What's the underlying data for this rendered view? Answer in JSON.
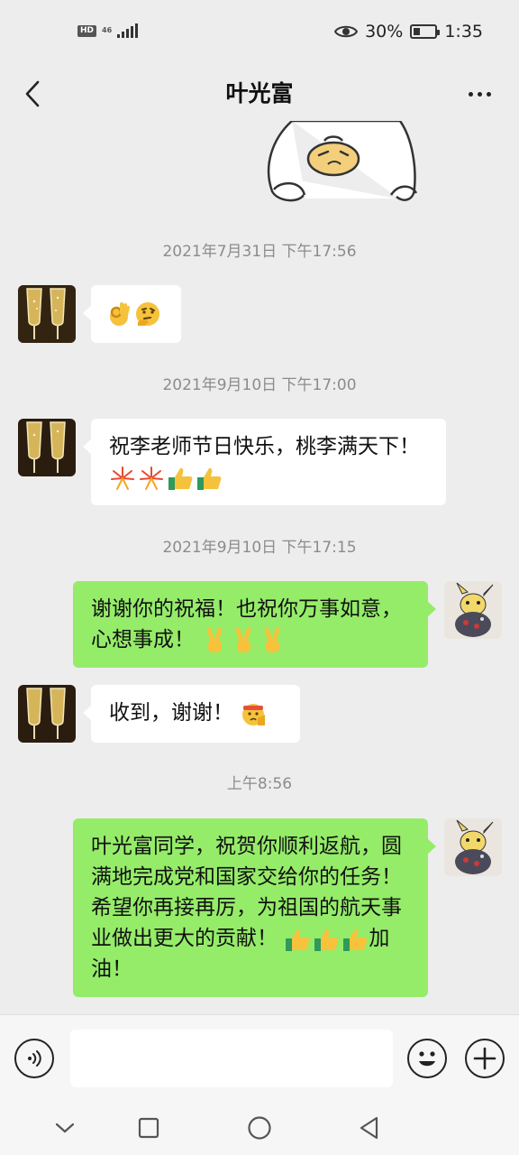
{
  "status_bar": {
    "hd": "HD",
    "network": "46",
    "battery_text": "30%",
    "battery_level": 0.3,
    "time": "1:35"
  },
  "header": {
    "title": "叶光富",
    "back_icon": "chevron-left-icon",
    "more_icon": "more-dots-icon"
  },
  "messages": {
    "ts1": "2021年7月31日 下午17:56",
    "m1_emojis": [
      "ok-hand-emoji",
      "thinking-emoji"
    ],
    "ts2": "2021年9月10日 下午17:00",
    "m2_text": "祝李老师节日快乐，桃李满天下！",
    "m2_emojis": [
      "fireworks-emoji",
      "fireworks-emoji",
      "thumbs-up-emoji",
      "thumbs-up-emoji"
    ],
    "ts3": "2021年9月10日 下午17:15",
    "m3_text": "谢谢你的祝福！也祝你万事如意，心想事成！",
    "m3_emojis": [
      "victory-hand-emoji",
      "victory-hand-emoji",
      "victory-hand-emoji"
    ],
    "m4_text": "收到，谢谢！",
    "m4_emojis": [
      "salute-emoji"
    ],
    "ts4": "上午8:56",
    "m5_text_a": "叶光富同学，祝贺你顺利返航，圆满地完成党和国家交给你的任务！希望你再接再厉，为祖国的航天事业做出更大的贡献！",
    "m5_emojis": [
      "thumbs-up-emoji",
      "thumbs-up-emoji",
      "thumbs-up-emoji"
    ],
    "m5_text_b": "加油！"
  },
  "colors": {
    "background": "#ededed",
    "bubble_out": "#95ec69",
    "bubble_in": "#ffffff",
    "timestamp": "#8c8c8c"
  },
  "input_bar": {
    "placeholder": "",
    "voice_icon": "voice-icon",
    "emoji_icon": "emoji-icon",
    "plus_icon": "plus-icon"
  },
  "nav": {
    "icons": [
      "chevron-down-icon",
      "recent-apps-icon",
      "home-icon",
      "back-triangle-icon"
    ]
  }
}
